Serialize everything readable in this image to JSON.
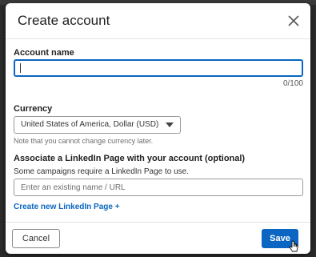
{
  "dialog": {
    "title": "Create account",
    "close_icon": "close-icon"
  },
  "account_name": {
    "label": "Account name",
    "value": "",
    "counter": "0/100"
  },
  "currency": {
    "label": "Currency",
    "selected": "United States of America, Dollar (USD)",
    "note": "Note that you cannot change currency later."
  },
  "linkedin_page": {
    "label": "Associate a LinkedIn Page with your account (optional)",
    "description": "Some campaigns require a LinkedIn Page to use.",
    "placeholder": "Enter an existing name / URL",
    "create_link": "Create new LinkedIn Page +"
  },
  "footer": {
    "cancel_label": "Cancel",
    "save_label": "Save"
  },
  "colors": {
    "accent": "#0a66c2"
  }
}
